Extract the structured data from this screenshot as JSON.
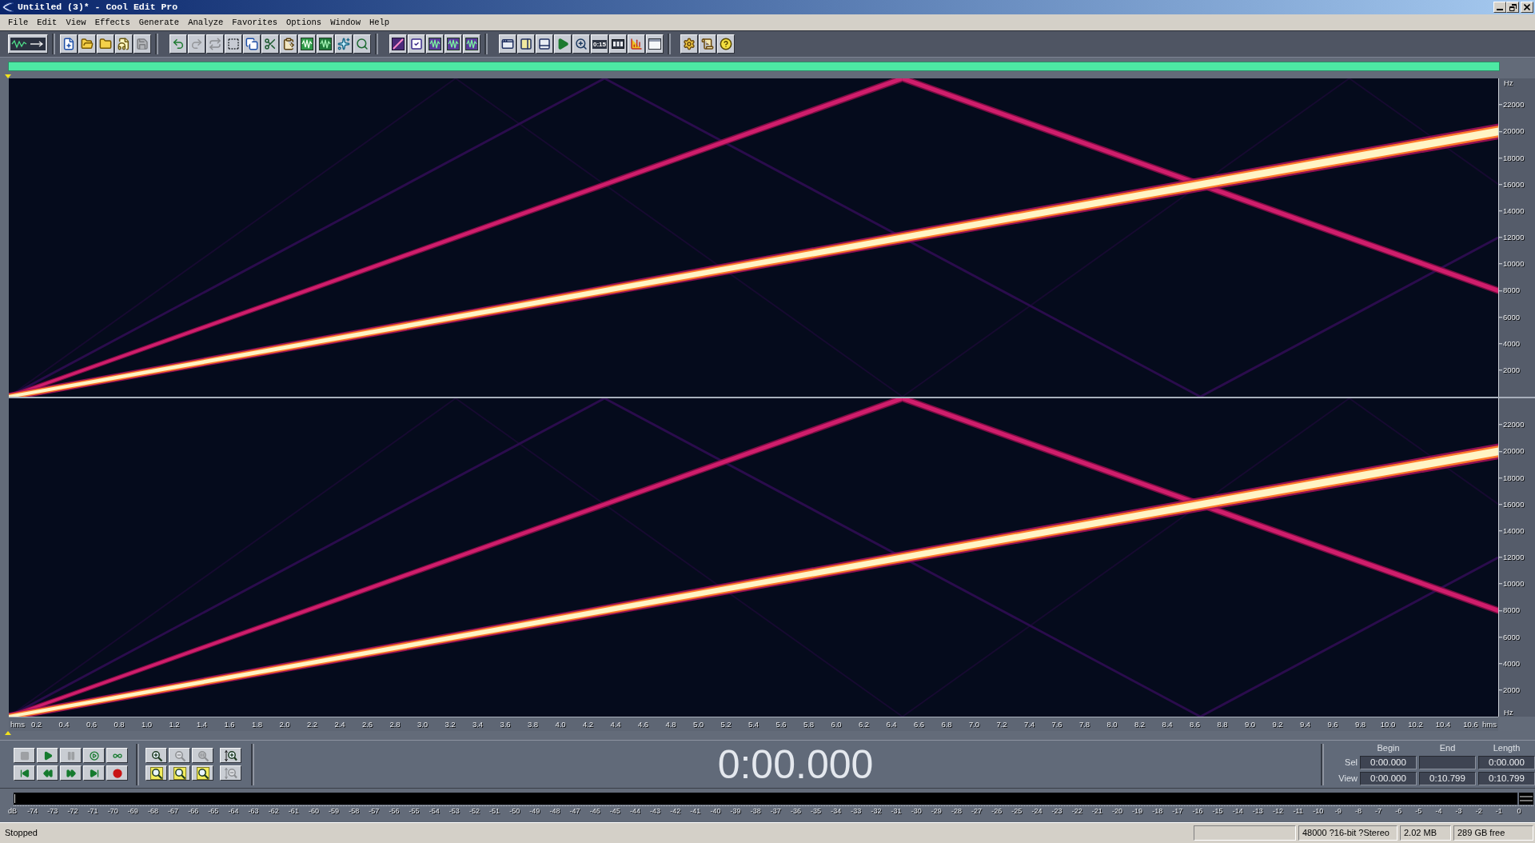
{
  "window": {
    "title": "Untitled (3)* - Cool Edit Pro"
  },
  "menu": [
    "File",
    "Edit",
    "View",
    "Effects",
    "Generate",
    "Analyze",
    "Favorites",
    "Options",
    "Window",
    "Help"
  ],
  "toolbar": {
    "buttons": [
      {
        "disabled": false
      },
      {
        "disabled": false
      },
      {
        "disabled": false
      },
      {
        "disabled": false
      },
      {
        "disabled": false
      },
      {
        "disabled": true
      },
      {
        "disabled": false
      },
      {
        "disabled": true
      },
      {
        "disabled": true
      },
      {
        "disabled": false
      },
      {
        "disabled": false
      },
      {
        "disabled": false
      },
      {
        "disabled": false
      },
      {
        "disabled": false
      },
      {
        "disabled": false
      },
      {
        "disabled": false
      },
      {
        "disabled": false
      },
      {
        "disabled": false
      },
      {
        "disabled": false
      },
      {
        "disabled": false
      },
      {
        "disabled": false
      },
      {
        "disabled": false
      },
      {
        "disabled": false
      },
      {
        "disabled": false
      },
      {
        "disabled": false
      },
      {
        "disabled": false
      },
      {
        "disabled": false
      },
      {
        "disabled": false
      },
      {
        "disabled": false
      },
      {
        "disabled": false
      },
      {
        "disabled": false
      },
      {
        "disabled": false
      },
      {
        "disabled": false
      },
      {
        "disabled": false
      }
    ],
    "time_label": "0:15"
  },
  "spectrogram": {
    "channels": [
      {
        "unit_top": "Hz",
        "ticks": [
          "22000",
          "20000",
          "18000",
          "16000",
          "14000",
          "12000",
          "10000",
          "8000",
          "6000",
          "4000",
          "2000"
        ]
      },
      {
        "ticks": [
          "22000",
          "20000",
          "18000",
          "16000",
          "14000",
          "12000",
          "10000",
          "8000",
          "6000",
          "4000",
          "2000"
        ],
        "unit_bottom": "Hz"
      }
    ]
  },
  "time_ruler": {
    "unit_left": "hms",
    "ticks": [
      "0.2",
      "0.4",
      "0.6",
      "0.8",
      "1.0",
      "1.2",
      "1.4",
      "1.6",
      "1.8",
      "2.0",
      "2.2",
      "2.4",
      "2.6",
      "2.8",
      "3.0",
      "3.2",
      "3.4",
      "3.6",
      "3.8",
      "4.0",
      "4.2",
      "4.4",
      "4.6",
      "4.8",
      "5.0",
      "5.2",
      "5.4",
      "5.6",
      "5.8",
      "6.0",
      "6.2",
      "6.4",
      "6.6",
      "6.8",
      "7.0",
      "7.2",
      "7.4",
      "7.6",
      "7.8",
      "8.0",
      "8.2",
      "8.4",
      "8.6",
      "8.8",
      "9.0",
      "9.2",
      "9.4",
      "9.6",
      "9.8",
      "10.0",
      "10.2",
      "10.4",
      "10.6"
    ],
    "unit_right": "hms"
  },
  "transport": {
    "buttons": [
      {
        "disabled": true
      },
      {
        "disabled": false
      },
      {
        "disabled": true
      },
      {
        "disabled": false
      },
      {
        "disabled": false
      },
      {
        "disabled": false
      },
      {
        "disabled": false
      },
      {
        "disabled": false
      },
      {
        "disabled": false
      },
      {
        "disabled": false
      }
    ],
    "zoom_buttons": [
      {
        "disabled": false
      },
      {
        "disabled": true
      },
      {
        "disabled": true
      },
      {
        "disabled": false
      },
      {
        "disabled": false
      },
      {
        "disabled": false
      },
      {
        "disabled": false
      },
      {
        "disabled": true
      }
    ],
    "time_display": "0:00.000"
  },
  "selection": {
    "headers": [
      "Begin",
      "End",
      "Length"
    ],
    "rows": [
      {
        "label": "Sel",
        "begin": "0:00.000",
        "length": "0:00.000"
      },
      {
        "label": "View",
        "begin": "0:00.000",
        "end": "0:10.799",
        "length": "0:10.799"
      }
    ]
  },
  "level_meter": {
    "unit": "dB",
    "ticks": [
      "-74",
      "-73",
      "-72",
      "-71",
      "-70",
      "-69",
      "-68",
      "-67",
      "-66",
      "-65",
      "-64",
      "-63",
      "-62",
      "-61",
      "-60",
      "-59",
      "-58",
      "-57",
      "-56",
      "-55",
      "-54",
      "-53",
      "-52",
      "-51",
      "-50",
      "-49",
      "-48",
      "-47",
      "-46",
      "-45",
      "-44",
      "-43",
      "-42",
      "-41",
      "-40",
      "-39",
      "-38",
      "-37",
      "-36",
      "-35",
      "-34",
      "-33",
      "-32",
      "-31",
      "-30",
      "-29",
      "-28",
      "-27",
      "-26",
      "-25",
      "-24",
      "-23",
      "-22",
      "-21",
      "-20",
      "-19",
      "-18",
      "-17",
      "-16",
      "-15",
      "-14",
      "-13",
      "-12",
      "-11",
      "-10",
      "-9",
      "-8",
      "-7",
      "-6",
      "-5",
      "-4",
      "-3",
      "-2",
      "-1",
      "0"
    ]
  },
  "status_bar": {
    "state": "Stopped",
    "format": "48000 ?16-bit ?Stereo",
    "size": "2.02 MB",
    "free": "289 GB free"
  }
}
